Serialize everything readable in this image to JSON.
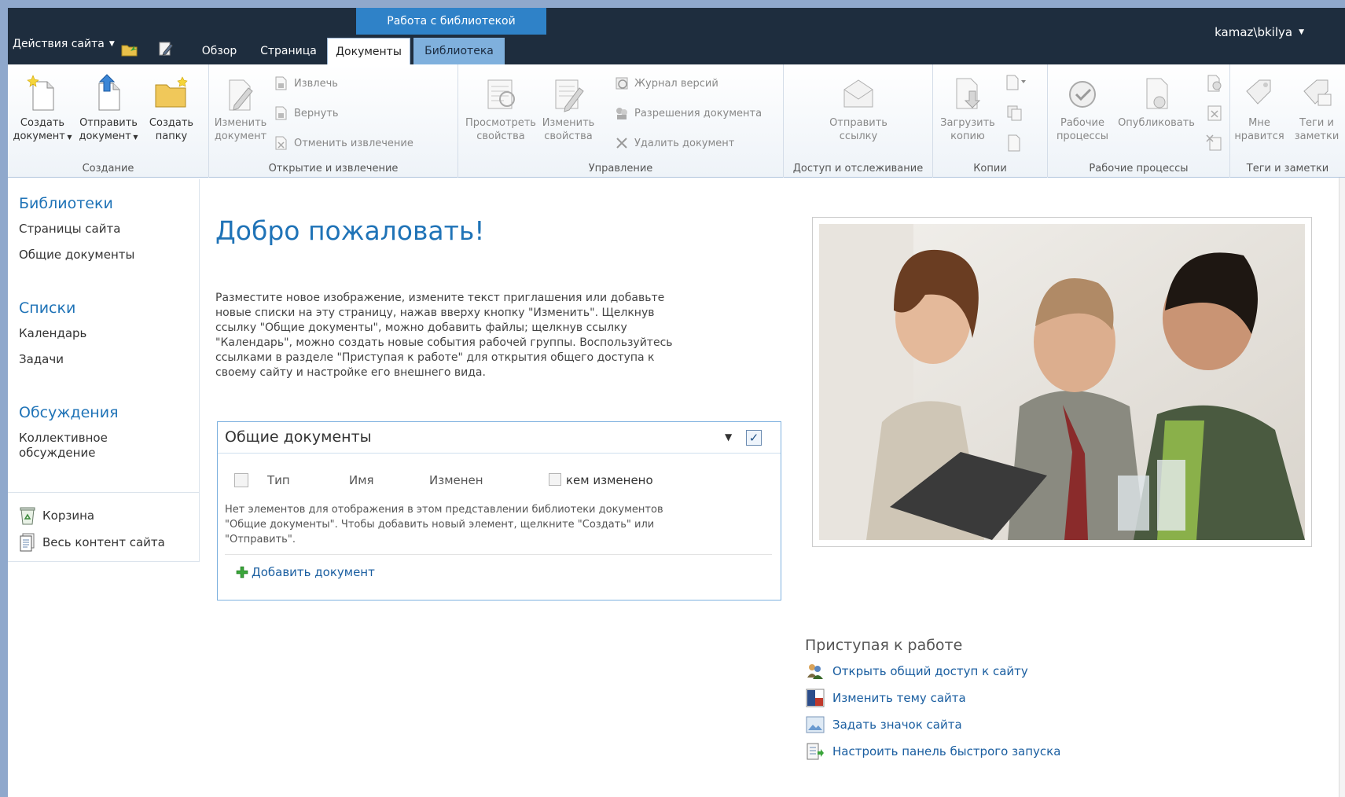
{
  "topbar": {
    "site_actions": "Действия сайта",
    "context_label": "Работа с библиотекой",
    "tabs": [
      "Обзор",
      "Страница",
      "Документы",
      "Библиотека"
    ],
    "user": "kamaz\\bkilya"
  },
  "ribbon": {
    "groups": {
      "create": "Создание",
      "open": "Открытие и извлечение",
      "manage": "Управление",
      "share": "Доступ и отслеживание",
      "copies": "Копии",
      "workflows": "Рабочие процессы",
      "tags": "Теги и заметки"
    },
    "buttons": {
      "new_doc_1": "Создать",
      "new_doc_2": "документ",
      "upload_1": "Отправить",
      "upload_2": "документ",
      "new_folder_1": "Создать",
      "new_folder_2": "папку",
      "edit_doc_1": "Изменить",
      "edit_doc_2": "документ",
      "check_out": "Извлечь",
      "check_in": "Вернуть",
      "discard_checkout": "Отменить извлечение",
      "view_props_1": "Просмотреть",
      "view_props_2": "свойства",
      "edit_props_1": "Изменить",
      "edit_props_2": "свойства",
      "version_history": "Журнал версий",
      "doc_permissions": "Разрешения документа",
      "delete_doc": "Удалить документ",
      "email_link_1": "Отправить",
      "email_link_2": "ссылку",
      "download_copy_1": "Загрузить",
      "download_copy_2": "копию",
      "workflows_1": "Рабочие",
      "workflows_2": "процессы",
      "publish": "Опубликовать",
      "like_1": "Мне",
      "like_2": "нравится",
      "tags_1": "Теги и",
      "tags_2": "заметки"
    }
  },
  "leftnav": {
    "libraries_head": "Библиотеки",
    "site_pages": "Страницы сайта",
    "shared_docs": "Общие документы",
    "lists_head": "Списки",
    "calendar": "Календарь",
    "tasks": "Задачи",
    "discussions_head": "Обсуждения",
    "team_discussion_1": "Коллективное",
    "team_discussion_2": "обсуждение",
    "recycle_bin": "Корзина",
    "all_content": "Весь контент сайта"
  },
  "main": {
    "title": "Добро пожаловать!",
    "intro_lines": [
      "Разместите новое изображение, измените текст приглашения или добавьте",
      "новые списки на эту страницу, нажав вверху кнопку \"Изменить\". Щелкнув",
      "ссылку \"Общие документы\", можно добавить файлы; щелкнув ссылку",
      "\"Календарь\", можно создать новые события рабочей группы. Воспользуйтесь",
      "ссылками в разделе \"Приступая к работе\" для открытия общего доступа к",
      "своему сайту и настройке его внешнего вида."
    ]
  },
  "webpart": {
    "title": "Общие документы",
    "columns": [
      "Тип",
      "Имя",
      "Изменен",
      "кем изменено"
    ],
    "empty_lines": [
      "Нет элементов для отображения в этом представлении библиотеки документов",
      "\"Общие документы\". Чтобы добавить новый элемент, щелкните \"Создать\" или",
      "\"Отправить\"."
    ],
    "add_doc": "Добавить документ"
  },
  "getting_started": {
    "title": "Приступая к работе",
    "links": [
      "Открыть общий доступ к сайту",
      "Изменить тему сайта",
      "Задать значок сайта",
      "Настроить панель быстрого запуска"
    ]
  },
  "colors": {
    "topbar": "#1e2d3e",
    "context_tab": "#2f82c8",
    "library_tab": "#7fb0dd",
    "link_blue": "#1f73b7"
  }
}
